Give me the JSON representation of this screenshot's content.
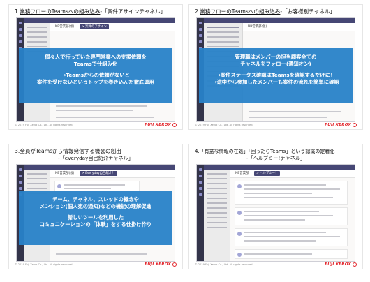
{
  "slides": [
    {
      "title_prefix": "1.",
      "title_underlined": "業務フローのTeamsへの組み込み",
      "title_suffix": "-「案件アサインチャネル」",
      "tab_team": "NB営業部(仮)",
      "tab_channel": "> 案件のアサイン",
      "overlay_lines": [
        "個々人で行っていた専門営業への支援依頼を",
        "Teamsで仕組み化",
        "→Teamsからの依頼がないと",
        "案件を受けないというトップを巻き込んだ徹底運用"
      ],
      "footer": "© 2019 Fuji Xerox Co., Ltd. All rights reserved.",
      "logo": "FUJI XEROX"
    },
    {
      "title_prefix": "2.",
      "title_underlined": "業務フローのTeamsへの組み込み",
      "title_suffix": "-「お客様別チャネル」",
      "tab_team": "NB営業部(仮)",
      "overlay_lines": [
        "管理職はメンバーの担当顧客全ての",
        "チャネルをフォロー(通知オン)",
        "→案件ステータス確認はTeamsを確認するだけに！",
        "→途中から参加したメンバーも案件の流れを簡単に確認"
      ],
      "footer": "© 2019 Fuji Xerox Co., Ltd. All rights reserved.",
      "logo": "FUJI XEROX"
    },
    {
      "title": "3.全員がTeamsから情報発信する機会の創出",
      "subtitle": "-「everyday自己紹介チャネル」",
      "tab_team": "NB営業部(仮)",
      "tab_channel": "> Everyday自己紹介！",
      "overlay_lines": [
        "チーム、チャネル、スレッドの概念や",
        "メンション(個人宛の通知)などの機能の理解促進",
        "新しいツールを利用した",
        "コミュニケーションの「体験」をする仕掛け作り"
      ],
      "footer": "© 2019 Fuji Xerox Co., Ltd. All rights reserved.",
      "logo": "FUJI XEROX"
    },
    {
      "title": "4.「有益な情報の在処」「困ったらTeams」という認識の定着化",
      "subtitle": "-「ヘルプミー!チャネル」",
      "tab_team": "NB営業部",
      "tab_channel": "> ヘルプミー！",
      "footer": "© 2019 Fuji Xerox Co., Ltd. All rights reserved.",
      "logo": "FUJI XEROX"
    }
  ],
  "colors": {
    "overlay": "#2882c8",
    "teams_purple": "#464775",
    "logo_red": "#e2242a",
    "highlight_red": "#e02020"
  }
}
